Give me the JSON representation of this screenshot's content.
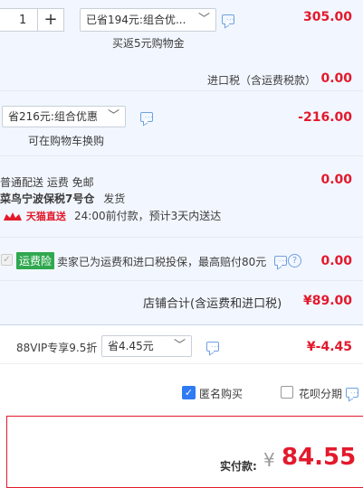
{
  "bundle": {
    "quantity": "1",
    "plus": "+",
    "promo_select": "已省194元:组合优...",
    "rebate": "买返5元购物金",
    "price": "305.00"
  },
  "import_tax": {
    "label": "进口税（含运费税款）",
    "value": "0.00"
  },
  "shop_discount": {
    "select": "省216元:组合优惠",
    "note": "可在购物车换购",
    "value": "-216.00"
  },
  "shipping": {
    "method": "普通配送 运费 免邮",
    "warehouse": "菜鸟宁波保税7号仓",
    "ship_note": "发货",
    "badge": "天猫直送",
    "eta": "24:00前付款，预计3天内送达",
    "value": "0.00"
  },
  "insurance": {
    "badge": "运费险",
    "desc": "卖家已为运费和进口税投保，最高赔付80元",
    "help": "?",
    "value": "0.00"
  },
  "store_total": {
    "label": "店铺合计(含运费和进口税)",
    "value": "¥89.00"
  },
  "vip": {
    "label": "88VIP专享9.5折",
    "select": "省4.45元",
    "value": "¥-4.45"
  },
  "options": {
    "anonymous": "匿名购买",
    "huabei": "花呗分期"
  },
  "payment": {
    "label": "实付款:",
    "currency": "¥",
    "amount": "84.55"
  },
  "colors": {
    "accent_red": "#e3192c",
    "panel_blue": "#f2f7ff",
    "link_blue": "#6fa0e0"
  }
}
